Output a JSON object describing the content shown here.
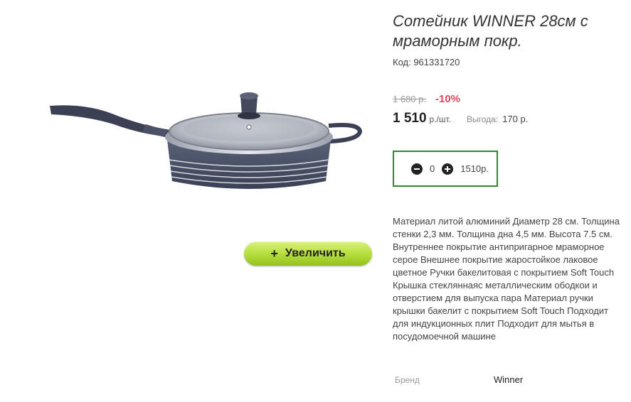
{
  "product": {
    "title": "Сотейник WINNER 28см с мраморным покр.",
    "code": "Код: 961331720",
    "image_name": "pan-with-lid-icon"
  },
  "zoom": {
    "plus": "+",
    "label": "Увеличить"
  },
  "pricing": {
    "old_price": "1 680 р.",
    "discount": "-10%",
    "price": "1 510",
    "unit": "р./шт.",
    "savings_label": "Выгода:",
    "savings_value": "170 р."
  },
  "cart": {
    "quantity": "0",
    "total": "1510р."
  },
  "description": "Материал литой алюминий Диаметр 28 см. Толщина стенки 2,3 мм. Толщина дна 4,5 мм. Высота 7.5 см. Внутреннее покрытие антипригарное мраморное серое Внешнее покрытие жаростойкое лаковое цветное Ручки бакелитовая с покрытием Soft Touch Крышка стекляннаяс металлическим ободкои и отверстием для выпуска пара Материал ручки крышки бакелит с покрытием Soft Touch Подходит для индукционных плит Подходит для мытья в посудомоечной машине",
  "brand": {
    "label": "Бренд",
    "value": "Winner"
  },
  "colors": {
    "accent_green": "#2d8a2d",
    "discount_red": "#e2455a",
    "button_green": "#b4dc3b"
  }
}
